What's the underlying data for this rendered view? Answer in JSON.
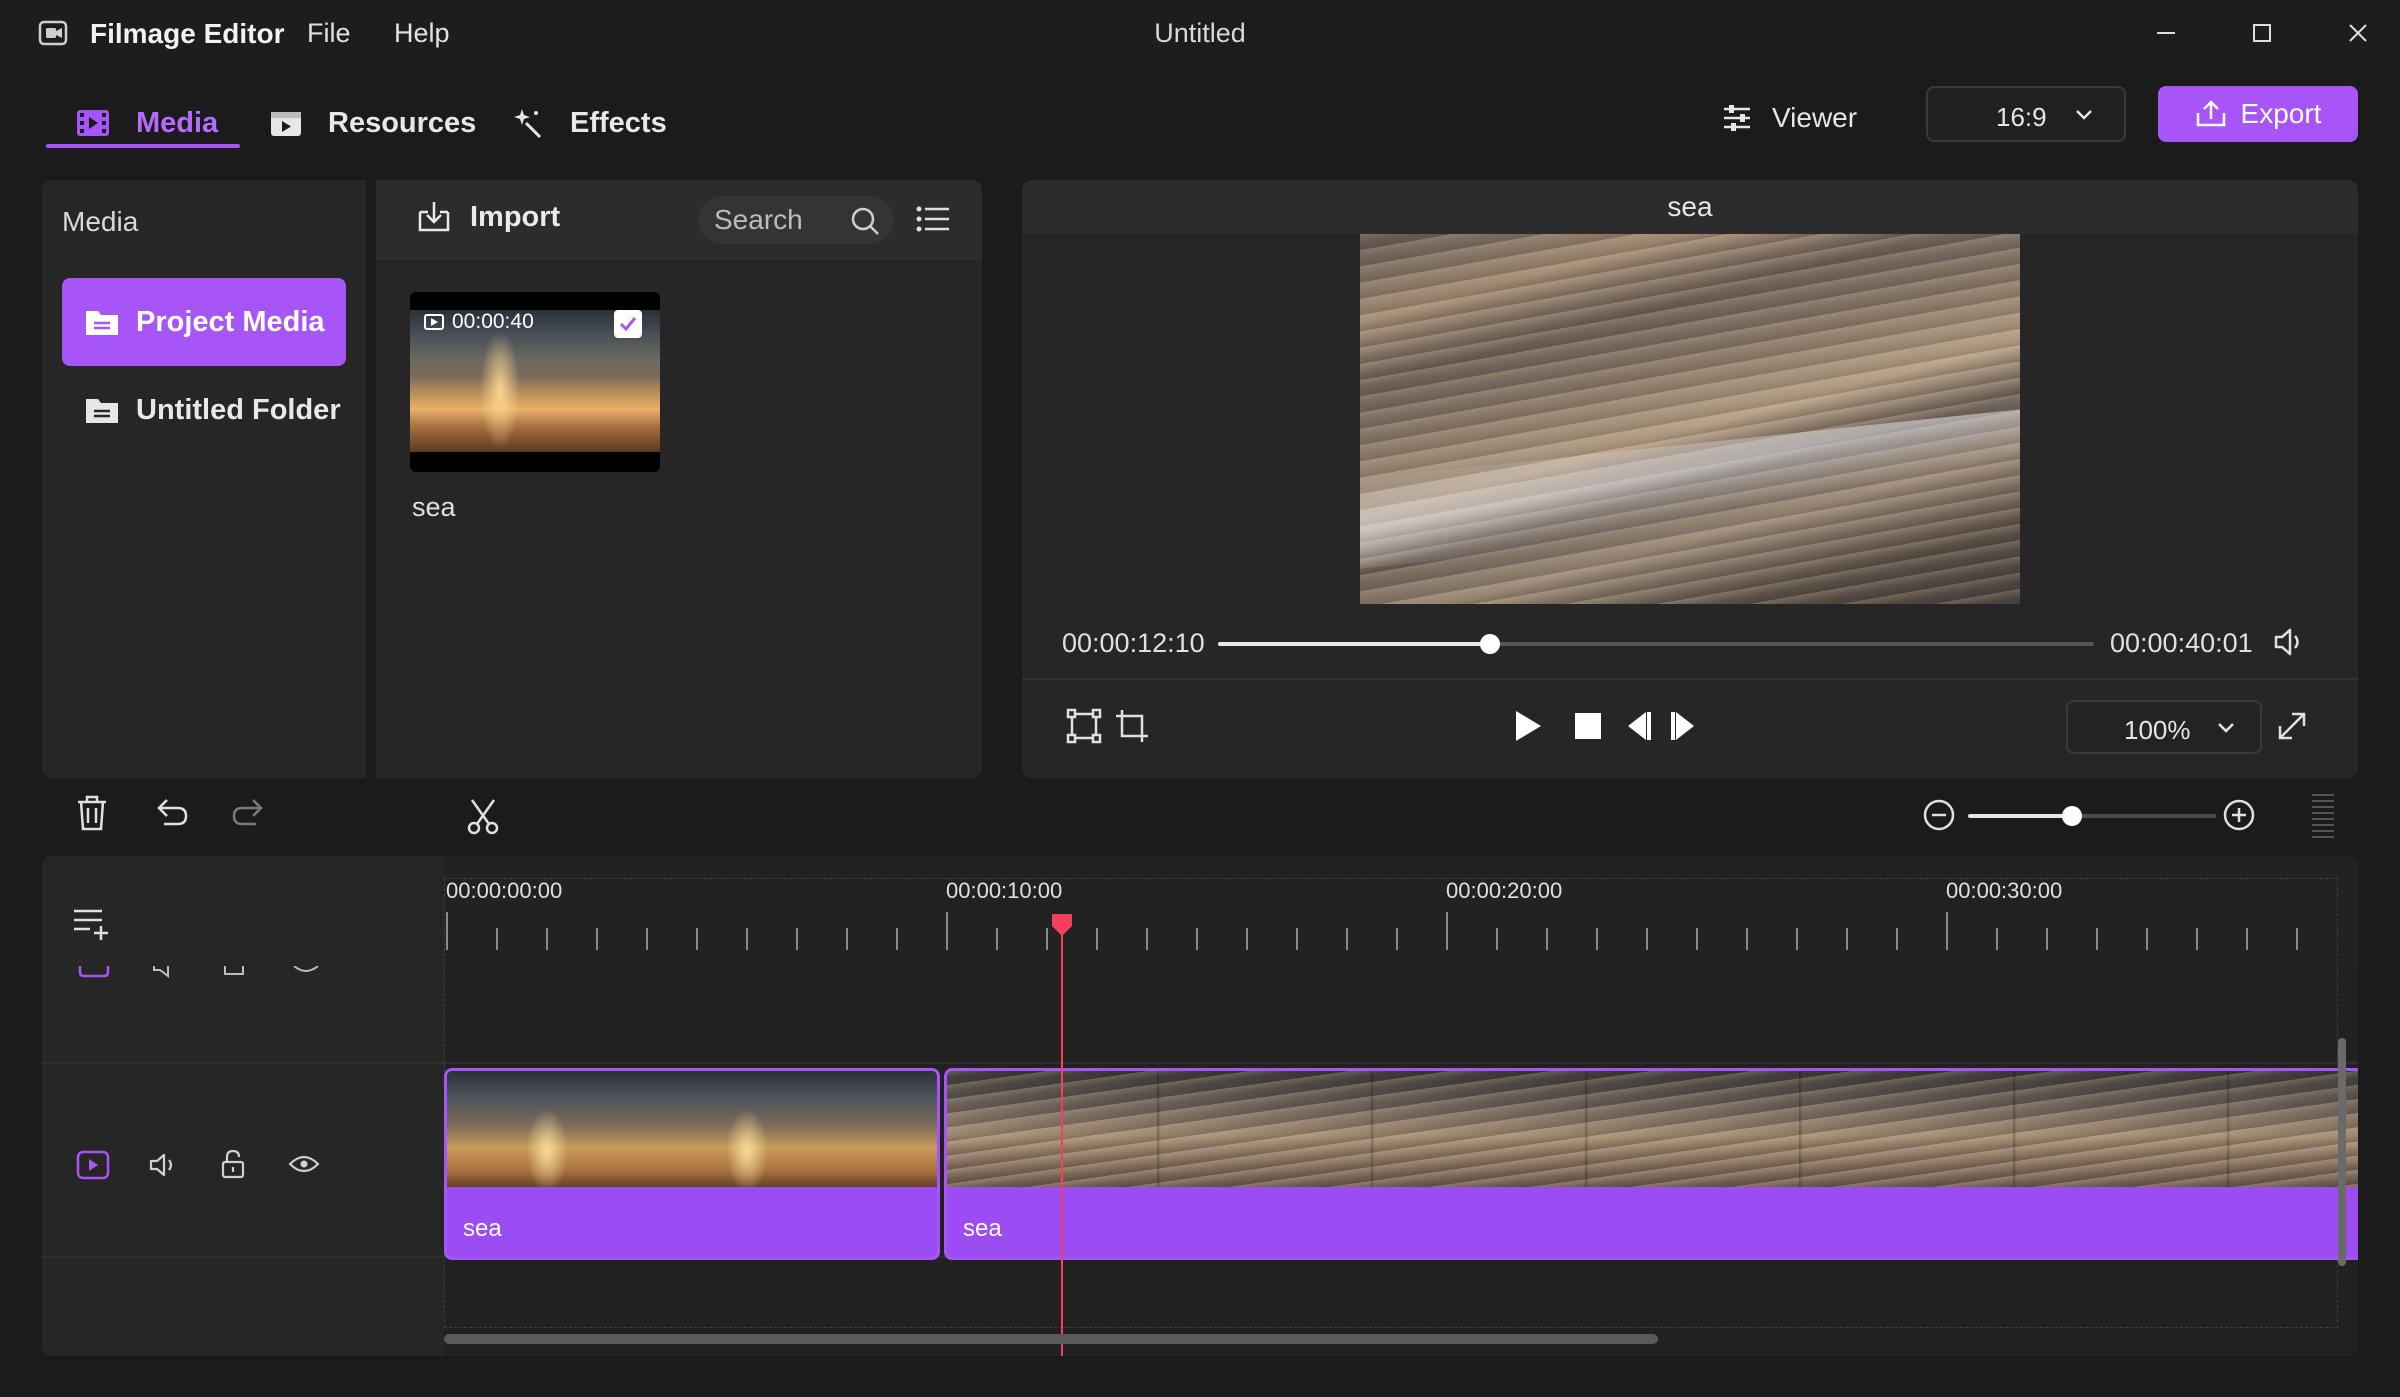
{
  "window": {
    "app_name": "Filmage Editor",
    "title": "Untitled",
    "menus": [
      "File",
      "Help"
    ]
  },
  "toolbar": {
    "tabs": [
      {
        "label": "Media",
        "icon": "film-icon",
        "active": true
      },
      {
        "label": "Resources",
        "icon": "resources-icon",
        "active": false
      },
      {
        "label": "Effects",
        "icon": "sparkle-icon",
        "active": false
      }
    ],
    "viewer_label": "Viewer",
    "aspect_ratio": "16:9",
    "export_label": "Export"
  },
  "media_panel": {
    "title": "Media",
    "folders": [
      {
        "label": "Project Media",
        "active": true
      },
      {
        "label": "Untitled Folder",
        "active": false
      }
    ],
    "import_label": "Import",
    "search_placeholder": "Search",
    "items": [
      {
        "name": "sea",
        "duration": "00:00:40",
        "selected": true
      }
    ]
  },
  "viewer": {
    "clip_title": "sea",
    "current_time": "00:00:12:10",
    "total_time": "00:00:40:01",
    "progress_fraction": 0.31,
    "zoom": "100%"
  },
  "edit_toolbar": {
    "timeline_zoom_fraction": 0.42
  },
  "timeline": {
    "ruler_labels": [
      "00:00:00:00",
      "00:00:10:00",
      "00:00:20:00",
      "00:00:30:00"
    ],
    "clips": [
      {
        "label": "sea"
      },
      {
        "label": "sea"
      }
    ],
    "colors": {
      "accent": "#a855f7",
      "playhead": "#f43f5e"
    }
  }
}
